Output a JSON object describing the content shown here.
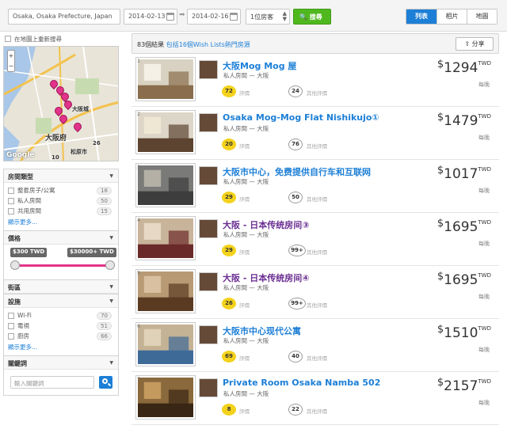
{
  "search": {
    "location": "Osaka, Osaka Prefecture, Japan",
    "checkin": "2014-02-13",
    "checkout": "2014-02-16",
    "guests": "1位房客",
    "button": "搜尋"
  },
  "views": [
    "列表",
    "相片",
    "地圖"
  ],
  "sidebar": {
    "map_checkbox_label": "在地圖上重新搜尋",
    "map_labels": [
      "大阪城",
      "大阪府",
      "松原市",
      "10",
      "26"
    ],
    "google_label": "Google",
    "room_type": {
      "title": "房間類型",
      "items": [
        {
          "label": "整套房子/公寓",
          "count": "18"
        },
        {
          "label": "私人房間",
          "count": "50"
        },
        {
          "label": "共用房間",
          "count": "15"
        }
      ],
      "more": "顯示更多..."
    },
    "price": {
      "title": "價格",
      "min_label": "$300 TWD",
      "max_label": "$30000+ TWD"
    },
    "neighborhood": {
      "title": "街區"
    },
    "amenities": {
      "title": "設施",
      "items": [
        {
          "label": "Wi-Fi",
          "count": "70"
        },
        {
          "label": "電視",
          "count": "51"
        },
        {
          "label": "廚房",
          "count": "66"
        }
      ],
      "more": "顯示更多..."
    },
    "keywords": {
      "title": "關鍵詞",
      "placeholder": "輸入關鍵詞"
    }
  },
  "results": {
    "count_text": "83個結果",
    "wishlist_link": "包括16個Wish Lists熱門房源",
    "share": "分享"
  },
  "listings": [
    {
      "num": "1",
      "title": "大阪Mog Mog 屋",
      "sub": "私人房間 — 大阪",
      "reviews": "72",
      "review_label": "評價",
      "other": "24",
      "other_label": "其他評價",
      "currency": "$",
      "price": "1294",
      "unit": "TWD",
      "per": "每晚",
      "color": "#1d7fd6"
    },
    {
      "num": "2",
      "title": "Osaka Mog-Mog Flat Nishikujo①",
      "sub": "私人房間 — 大阪",
      "reviews": "20",
      "review_label": "評價",
      "other": "76",
      "other_label": "其他評價",
      "currency": "$",
      "price": "1479",
      "unit": "TWD",
      "per": "每晚",
      "color": "#1d7fd6"
    },
    {
      "num": "3",
      "title": "大阪市中心，免费提供自行车和互联网",
      "sub": "私人房間 — 大阪",
      "reviews": "29",
      "review_label": "評價",
      "other": "50",
      "other_label": "其他評價",
      "currency": "$",
      "price": "1017",
      "unit": "TWD",
      "per": "每晚",
      "color": "#1d7fd6"
    },
    {
      "num": "4",
      "title": "大阪 - 日本传统房间③",
      "sub": "私人房間 — 大阪",
      "reviews": "29",
      "review_label": "評價",
      "other": "99+",
      "other_label": "其他評價",
      "currency": "$",
      "price": "1695",
      "unit": "TWD",
      "per": "每晚",
      "color": "#6a2c91"
    },
    {
      "num": "5",
      "title": "大阪 - 日本传统房间④",
      "sub": "私人房間 — 大阪",
      "reviews": "26",
      "review_label": "評價",
      "other": "99+",
      "other_label": "其他評價",
      "currency": "$",
      "price": "1695",
      "unit": "TWD",
      "per": "每晚",
      "color": "#6a2c91"
    },
    {
      "num": "6",
      "title": "大阪市中心现代公寓",
      "sub": "私人房間 — 大阪",
      "reviews": "69",
      "review_label": "評價",
      "other": "40",
      "other_label": "其他評價",
      "currency": "$",
      "price": "1510",
      "unit": "TWD",
      "per": "每晚",
      "color": "#1d7fd6"
    },
    {
      "num": "7",
      "title": "Private Room Osaka Namba 502",
      "sub": "私人房間 — 大阪",
      "reviews": "8",
      "review_label": "評價",
      "other": "22",
      "other_label": "其他評價",
      "currency": "$",
      "price": "2157",
      "unit": "TWD",
      "per": "每晚",
      "color": "#1d7fd6"
    }
  ]
}
